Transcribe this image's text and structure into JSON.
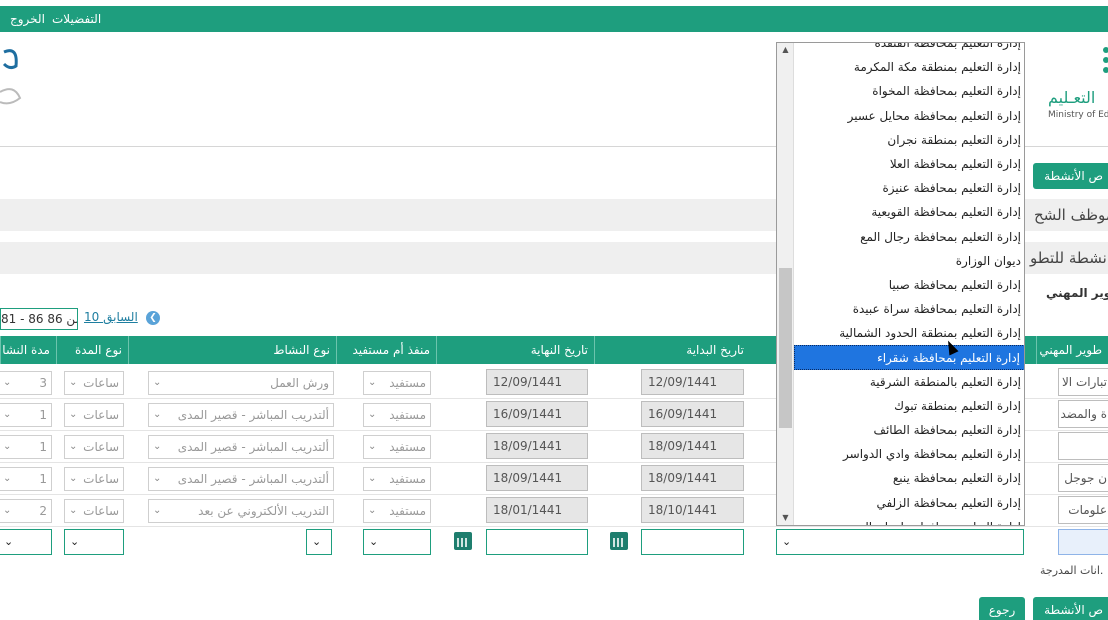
{
  "topbar": {
    "preferences": "التفضيلات",
    "logout": "الخروج"
  },
  "logo": {
    "ar": "التعـليم",
    "en": "Ministry of Ed"
  },
  "buttons": {
    "activities_top": "ص الأنشطة",
    "activities_bottom": "ص الأنشطة",
    "back": "رجوع"
  },
  "headings": {
    "employee": "موظف الشح",
    "activities": "نشطة للتطو",
    "dev_label": "طوير المهني"
  },
  "pager": {
    "range": "81 - 86 من 86",
    "prev": "10 السابق"
  },
  "table": {
    "headers": {
      "dev": "طوير المهني",
      "start": "تاريخ البداية",
      "end": "تاريخ النهاية",
      "outlet": "منفذ أم مستفيد",
      "type": "نوع النشاط",
      "dur_type": "نوع المدة",
      "dur": "مدة النشا"
    },
    "rows": [
      {
        "start": "12/09/1441",
        "end": "12/09/1441",
        "outlet": "مستفيد",
        "type": "ورش العمل",
        "dur_type": "ساعات",
        "dur": "3",
        "dev": "تبارات الا"
      },
      {
        "start": "16/09/1441",
        "end": "16/09/1441",
        "outlet": "مستفيد",
        "type": "ألتدريب المباشر - قصير المدى",
        "dur_type": "ساعات",
        "dur": "1",
        "dev": "ة والمضد"
      },
      {
        "start": "18/09/1441",
        "end": "18/09/1441",
        "outlet": "مستفيد",
        "type": "ألتدريب المباشر - قصير المدى",
        "dur_type": "ساعات",
        "dur": "1",
        "dev": ""
      },
      {
        "start": "18/09/1441",
        "end": "18/09/1441",
        "outlet": "مستفيد",
        "type": "ألتدريب المباشر - قصير المدى",
        "dur_type": "ساعات",
        "dur": "1",
        "dev": "ن جوجل"
      },
      {
        "start": "18/10/1441",
        "end": "18/01/1441",
        "outlet": "مستفيد",
        "type": "التدريب الألكتروني عن بعد",
        "dur_type": "ساعات",
        "dur": "2",
        "dev": "علومات"
      }
    ]
  },
  "dropdown": {
    "items": [
      "إدارة التعليم بمحافظة القنفذة",
      "إدارة التعليم بمنطقة مكة المكرمة",
      "إدارة التعليم بمحافظة المخواة",
      "إدارة التعليم بمحافظة محايل عسير",
      "إدارة التعليم بمنطقة نجران",
      "إدارة التعليم بمحافظة العلا",
      "إدارة التعليم بمحافظة عنيزة",
      "إدارة التعليم بمحافظة القويعية",
      "إدارة التعليم بمحافظة رجال المع",
      "ديوان الوزارة",
      "إدارة التعليم بمحافظة صبيا",
      "إدارة التعليم بمحافظة سراة عبيدة",
      "إدارة التعليم بمنطقة الحدود الشمالية",
      "إدارة التعليم بمحافظة شقراء",
      "إدارة التعليم بالمنطقة الشرقية",
      "إدارة التعليم بمنطقة تبوك",
      "إدارة التعليم بمحافظة الطائف",
      "إدارة التعليم بمحافظة وادي الدواسر",
      "إدارة التعليم بمحافظة ينبع",
      "إدارة التعليم بمحافظة الزلفي",
      "إدارة التعليم بمحافظة ظهران الجنوب"
    ],
    "selected_index": 13
  },
  "footnote": "انات المدرجة."
}
